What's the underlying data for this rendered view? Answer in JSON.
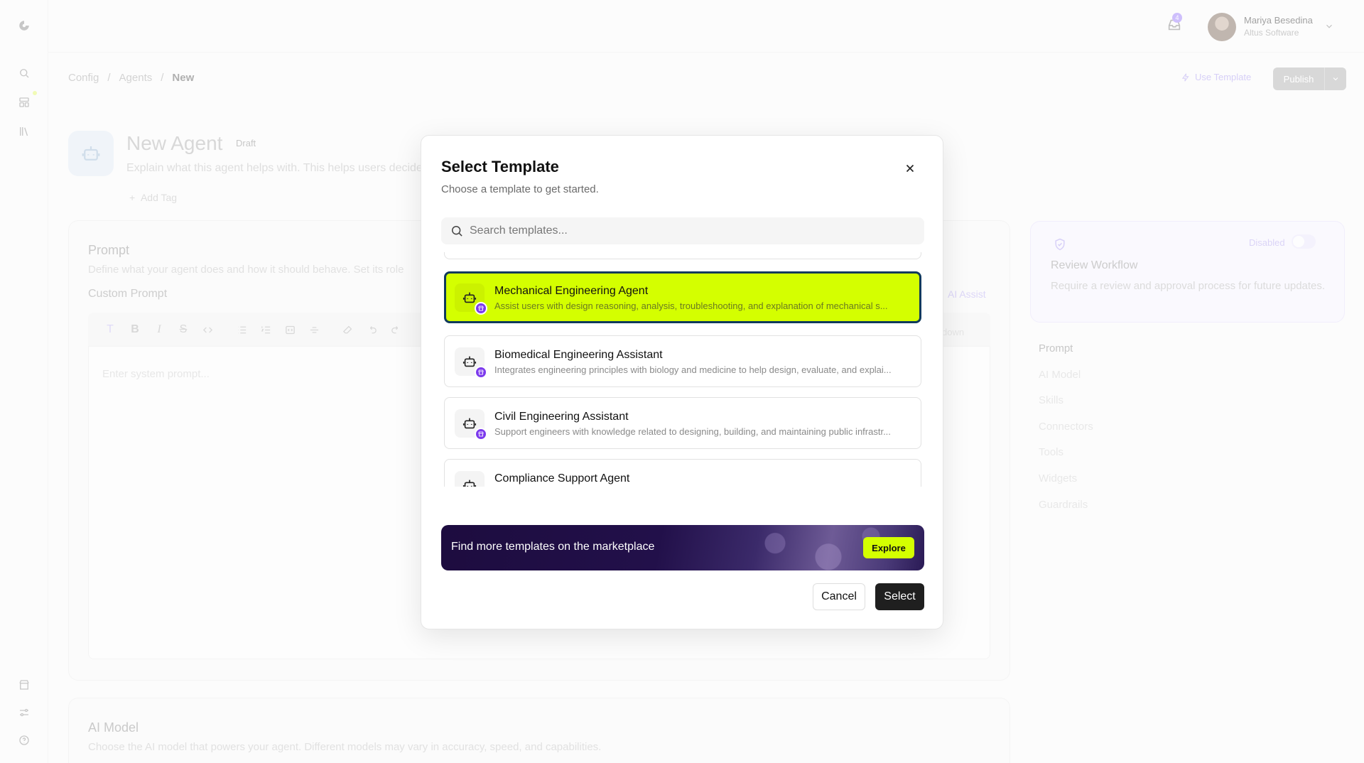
{
  "app": {
    "rail_icons": [
      "logo-icon",
      "search-icon",
      "dashboard-icon",
      "library-icon",
      "store-icon",
      "settings-sliders-icon",
      "help-icon"
    ]
  },
  "header": {
    "inbox_badge": "4",
    "user_name": "Mariya Besedina",
    "user_org": "Altus Software"
  },
  "breadcrumb": [
    "Config",
    "Agents",
    "New"
  ],
  "actions": {
    "use_template": "Use Template",
    "publish": "Publish"
  },
  "agent": {
    "title": "New Agent",
    "status": "Draft",
    "description": "Explain what this agent helps with. This helps users decide",
    "add_tag": "Add Tag"
  },
  "prompt_section": {
    "title": "Prompt",
    "description": "Define what your agent does and how it should behave. Set its role",
    "custom_prompt_label": "Custom Prompt",
    "ai_assist": "AI Assist",
    "markdown_label": "down",
    "editor_placeholder": "Enter system prompt..."
  },
  "ai_model_section": {
    "title": "AI Model",
    "description": "Choose the AI model that powers your agent. Different models may vary in accuracy, speed, and capabilities."
  },
  "review_workflow": {
    "title": "Review Workflow",
    "status": "Disabled",
    "description": "Require a review and approval process for future updates."
  },
  "side_nav": [
    "Prompt",
    "AI Model",
    "Skills",
    "Connectors",
    "Tools",
    "Widgets",
    "Guardrails"
  ],
  "dialog": {
    "title": "Select Template",
    "subtitle": "Choose a template to get started.",
    "search_placeholder": "Search templates...",
    "search_value": "",
    "templates": [
      {
        "name": "Mechanical Engineering Agent",
        "description": "Assist users with design reasoning, analysis, troubleshooting, and explanation of mechanical s...",
        "selected": true
      },
      {
        "name": "Biomedical Engineering Assistant",
        "description": "Integrates engineering principles with biology and medicine to help design, evaluate, and explai...",
        "selected": false
      },
      {
        "name": "Civil Engineering Assistant",
        "description": "Support engineers with knowledge related to designing, building, and maintaining public infrastr...",
        "selected": false
      },
      {
        "name": "Compliance Support Agent",
        "description": "",
        "selected": false
      }
    ],
    "banner_text": "Find more templates on the marketplace",
    "explore_label": "Explore",
    "cancel_label": "Cancel",
    "select_label": "Select"
  },
  "colors": {
    "accent_lime": "#d4ff00",
    "selected_border": "#103a5c",
    "marketplace_badge": "#7c3aed",
    "primary_button": "#1f1f1f"
  }
}
